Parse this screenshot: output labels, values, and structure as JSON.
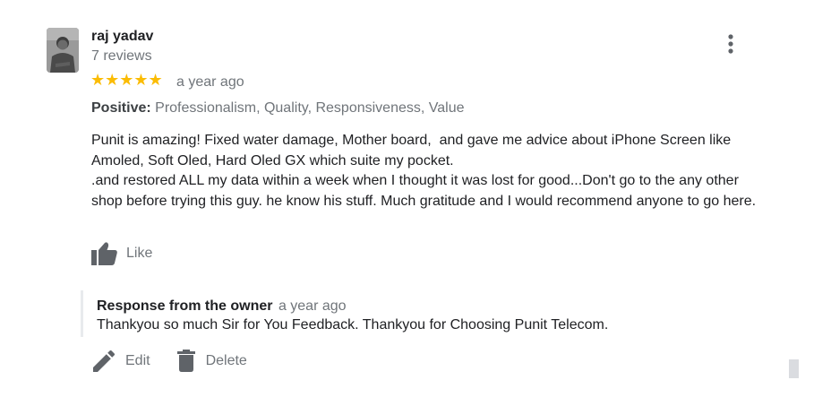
{
  "review": {
    "author_name": "raj yadav",
    "author_reviews": "7 reviews",
    "rating": 5,
    "rating_max": 5,
    "stars_text": "★★★★★",
    "time": "a year ago",
    "positive_label": "Positive:",
    "positive_values": "Professionalism, Quality, Responsiveness, Value",
    "text": "Punit is amazing! Fixed water damage, Mother board,  and gave me advice about iPhone Screen like Amoled, Soft Oled, Hard Oled GX which suite my pocket.\n.and restored ALL my data within a week when I thought it was lost for good...Don't go to the any other shop before trying this guy. he know his stuff. Much gratitude and I would recommend anyone to go here.",
    "like_label": "Like"
  },
  "owner_response": {
    "label": "Response from the owner",
    "time": "a year ago",
    "text": "Thankyou so much Sir for You Feedback. Thankyou for Choosing Punit Telecom."
  },
  "actions": {
    "edit_label": "Edit",
    "delete_label": "Delete"
  },
  "icons": {
    "more": "more-vert-icon",
    "like": "thumb-up-icon",
    "edit": "pencil-icon",
    "delete": "trash-icon",
    "star": "star-icon"
  },
  "colors": {
    "star": "#fbbc04",
    "muted_text": "#70757a",
    "icon": "#5f6368"
  }
}
